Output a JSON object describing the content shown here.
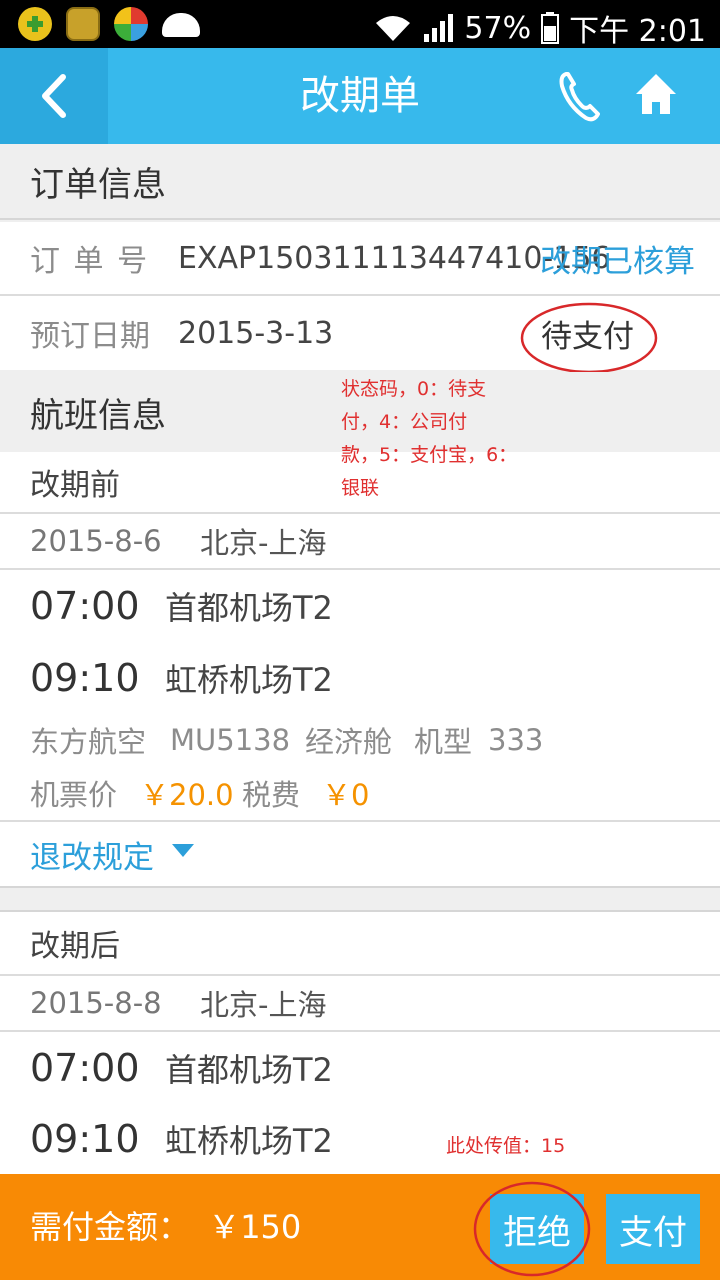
{
  "status_bar": {
    "battery": "57%",
    "time": "下午 2:01"
  },
  "nav": {
    "title": "改期单"
  },
  "order": {
    "section_title": "订单信息",
    "order_no_label": "订 单 号",
    "order_no": "EXAP150311113447410-156",
    "order_status": "改期已核算",
    "book_date_label": "预订日期",
    "book_date": "2015-3-13",
    "pay_status": "待支付"
  },
  "flight": {
    "section_title": "航班信息",
    "before": {
      "title": "改期前",
      "date": "2015-8-6",
      "route": "北京-上海",
      "dep_time": "07:00",
      "dep_airport": "首都机场T2",
      "arr_time": "09:10",
      "arr_airport": "虹桥机场T2",
      "airline": "东方航空",
      "flight_no": "MU5138",
      "cabin": "经济舱",
      "aircraft_label": "机型",
      "aircraft": "333",
      "price_label": "机票价",
      "price": "￥20.0",
      "tax_label": "税费",
      "tax": "￥0",
      "rules_label": "退改规定"
    },
    "after": {
      "title": "改期后",
      "date": "2015-8-8",
      "route": "北京-上海",
      "dep_time": "07:00",
      "dep_airport": "首都机场T2",
      "arr_time": "09:10",
      "arr_airport": "虹桥机场T2"
    }
  },
  "annotations": {
    "status_note_l1": "状态码，0：待支",
    "status_note_l2": "付，4：公司付",
    "status_note_l3": "款，5：支付宝，6：",
    "status_note_l4": "银联",
    "value_note": "此处传值：15"
  },
  "bottom": {
    "amount_label": "需付金额：",
    "amount": "￥150",
    "reject_label": "拒绝",
    "pay_label": "支付"
  },
  "colors": {
    "nav": "#37b9ec",
    "bottom": "#f88a05",
    "accent_blue": "#2c9fda",
    "price_orange": "#f59200"
  }
}
